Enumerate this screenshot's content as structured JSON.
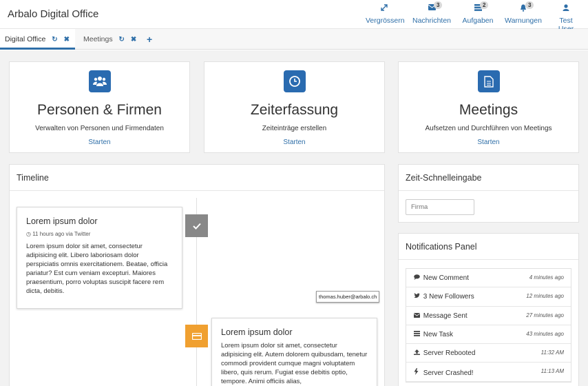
{
  "app": {
    "title": "Arbalo Digital Office"
  },
  "nav": [
    {
      "label": "Vergrössern",
      "icon": "expand-icon",
      "badge": ""
    },
    {
      "label": "Nachrichten",
      "icon": "envelope-icon",
      "badge": "3"
    },
    {
      "label": "Aufgaben",
      "icon": "tasks-icon",
      "badge": "2"
    },
    {
      "label": "Warnungen",
      "icon": "bell-icon",
      "badge": "3"
    },
    {
      "label": "Test User",
      "icon": "user-icon",
      "badge": ""
    }
  ],
  "tabs": [
    {
      "label": "Digital Office",
      "active": true
    },
    {
      "label": "Meetings",
      "active": false
    }
  ],
  "tiles": [
    {
      "title": "Personen & Firmen",
      "subtitle": "Verwalten von Personen und Firmendaten",
      "link": "Starten",
      "icon": "people-icon"
    },
    {
      "title": "Zeiterfassung",
      "subtitle": "Zeiteinträge erstellen",
      "link": "Starten",
      "icon": "clock-icon"
    },
    {
      "title": "Meetings",
      "subtitle": "Aufsetzen und Durchführen von Meetings",
      "link": "Starten",
      "icon": "document-icon"
    }
  ],
  "timeline": {
    "title": "Timeline",
    "items": [
      {
        "title": "Lorem ipsum dolor",
        "meta": "11 hours ago via Twitter",
        "body": "Lorem ipsum dolor sit amet, consectetur adipisicing elit. Libero laboriosam dolor perspiciatis omnis exercitationem. Beatae, officia pariatur? Est cum veniam excepturi. Maiores praesentium, porro voluptas suscipit facere rem dicta, debitis.",
        "marker_color": "#888888",
        "marker_icon": "check-icon"
      },
      {
        "title": "Lorem ipsum dolor",
        "meta": "",
        "body": "Lorem ipsum dolor sit amet, consectetur adipisicing elit. Autem dolorem quibusdam, tenetur commodi provident cumque magni voluptatem libero, quis rerum. Fugiat esse debitis optio, tempore. Animi officiis alias,",
        "marker_color": "#f0a030",
        "marker_icon": "credit-card-icon"
      }
    ],
    "tooltip": "thomas.huber@arbalo.ch"
  },
  "zeit": {
    "title": "Zeit-Schnelleingabe",
    "placeholder": "Firma"
  },
  "notifications": {
    "title": "Notifications Panel",
    "items": [
      {
        "label": "New Comment",
        "time": "4 minutes ago",
        "icon": "comment-icon"
      },
      {
        "label": "3 New Followers",
        "time": "12 minutes ago",
        "icon": "twitter-icon"
      },
      {
        "label": "Message Sent",
        "time": "27 minutes ago",
        "icon": "envelope-icon"
      },
      {
        "label": "New Task",
        "time": "43 minutes ago",
        "icon": "tasks-icon"
      },
      {
        "label": "Server Rebooted",
        "time": "11:32 AM",
        "icon": "upload-icon"
      },
      {
        "label": "Server Crashed!",
        "time": "11:13 AM",
        "icon": "bolt-icon"
      }
    ]
  },
  "colors": {
    "accent": "#2f6fa8",
    "tile_icon_bg": "#2a6bb0",
    "background": "#f2f2f2"
  }
}
